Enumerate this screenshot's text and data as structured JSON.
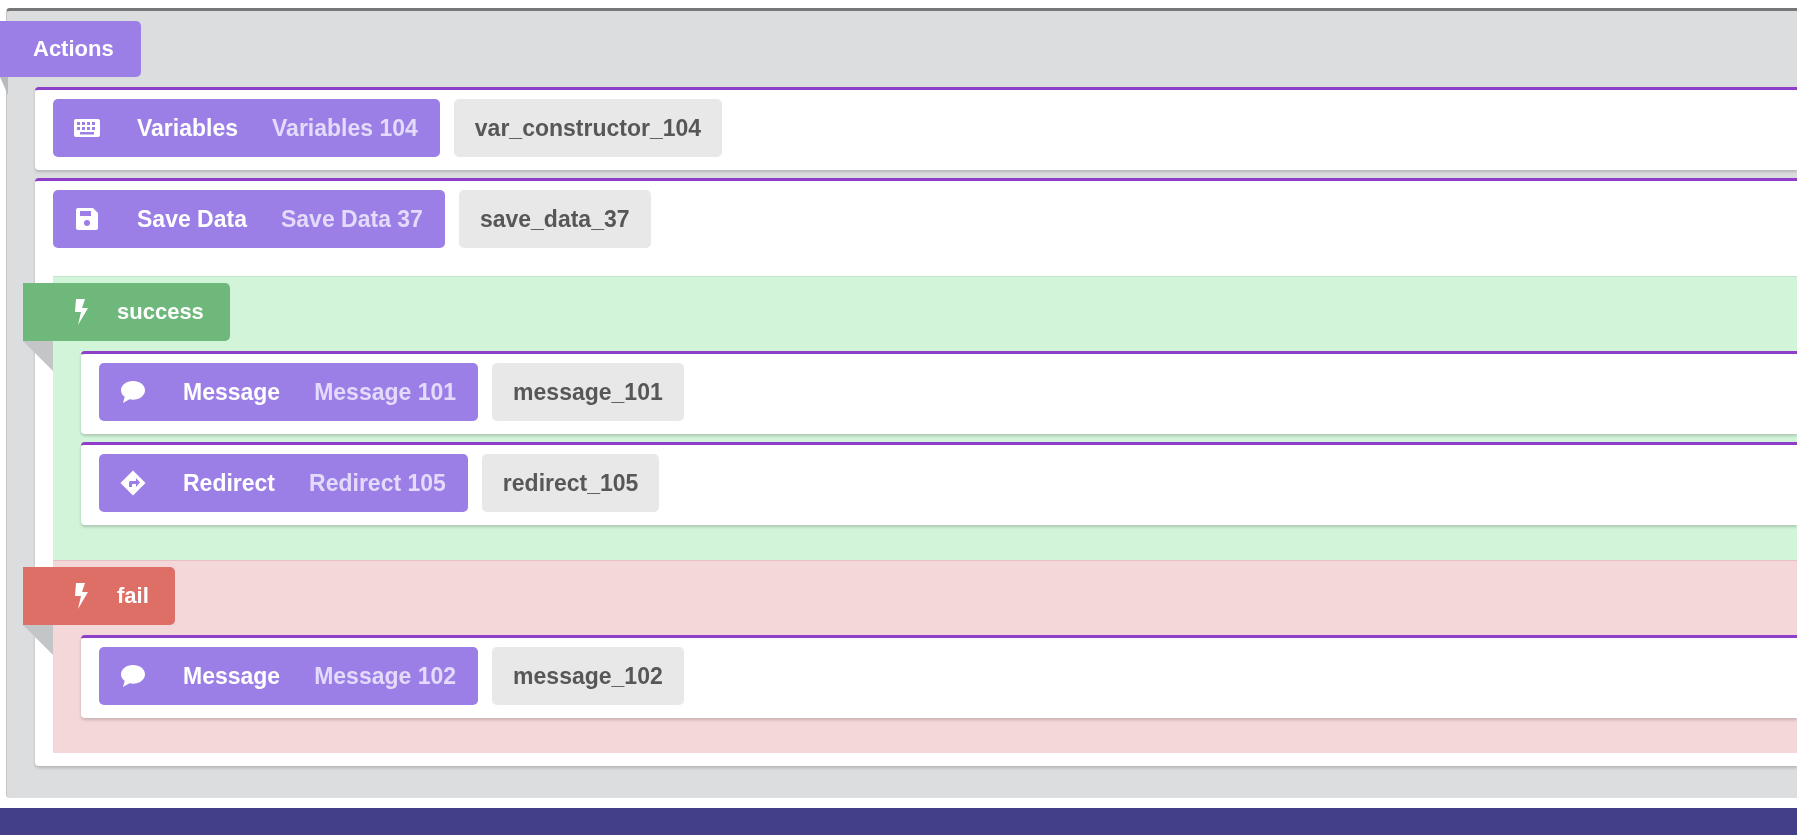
{
  "panel": {
    "label": "Actions"
  },
  "actions": [
    {
      "kind": "variables",
      "name": "Variables",
      "title": "Variables 104",
      "id": "var_constructor_104"
    },
    {
      "kind": "save",
      "name": "Save Data",
      "title": "Save Data 37",
      "id": "save_data_37",
      "branches": [
        {
          "kind": "success",
          "label": "success",
          "actions": [
            {
              "kind": "message",
              "name": "Message",
              "title": "Message 101",
              "id": "message_101"
            },
            {
              "kind": "redirect",
              "name": "Redirect",
              "title": "Redirect 105",
              "id": "redirect_105"
            }
          ]
        },
        {
          "kind": "fail",
          "label": "fail",
          "actions": [
            {
              "kind": "message",
              "name": "Message",
              "title": "Message 102",
              "id": "message_102"
            }
          ]
        }
      ]
    }
  ]
}
